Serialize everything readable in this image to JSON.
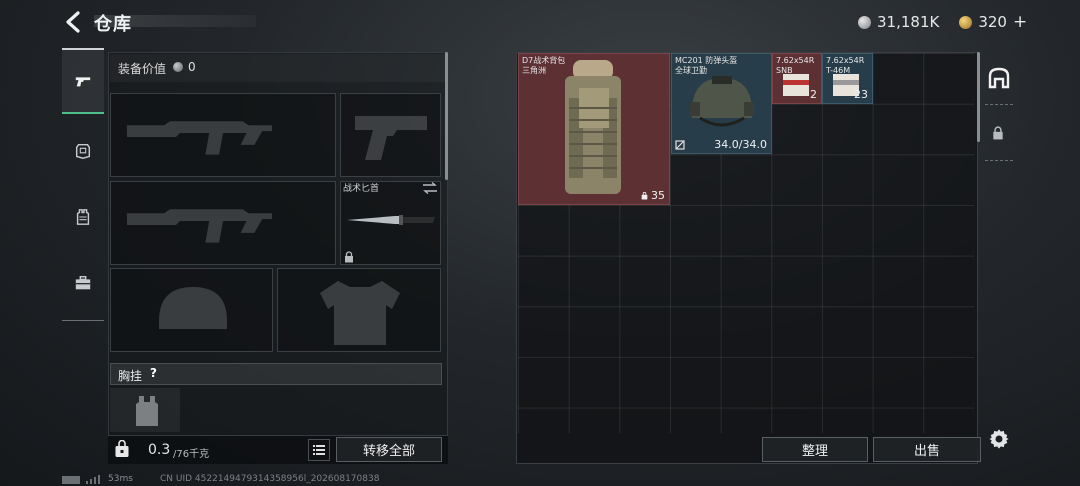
{
  "header": {
    "title": "仓库",
    "silver_amount": "31,181K",
    "gold_amount": "320",
    "plus_label": "+"
  },
  "equipment": {
    "value_label": "装备价值",
    "value_amount": "0",
    "knife_label": "战术匕首",
    "vest_label": "胸挂",
    "vest_help": "?"
  },
  "carry": {
    "weight_current": "0.3",
    "weight_max": "/76千克",
    "transfer_all_label": "转移全部"
  },
  "storage": {
    "items": [
      {
        "name_line1": "D7战术背包",
        "name_line2": "三角洲",
        "count": "35",
        "rarity_color": "#5d3034"
      },
      {
        "name_line1": "MC201 防弹头盔",
        "name_line2": "全球卫勤",
        "count": "34.0/34.0",
        "rarity_color": "#283d4a"
      },
      {
        "name_line1": "7.62x54R",
        "name_line2": "SNB",
        "count": "2",
        "rarity_color": "#5d3034"
      },
      {
        "name_line1": "7.62x54R",
        "name_line2": "T-46M",
        "count": "23",
        "rarity_color": "#283d4a"
      }
    ],
    "sort_label": "整理",
    "sell_label": "出售"
  },
  "footer": {
    "ping": "53ms",
    "uid": "CN UID 4522149479314358956l_202608170838"
  },
  "icons": [
    "back-arrow-icon",
    "silver-coin-icon",
    "gold-coin-icon",
    "pistol-icon",
    "armor-icon",
    "vest-icon",
    "briefcase-icon",
    "lock-icon",
    "swap-icon",
    "list-icon",
    "bag-icon",
    "settings-gear-icon",
    "storage-tab-icon",
    "signal-icon"
  ]
}
